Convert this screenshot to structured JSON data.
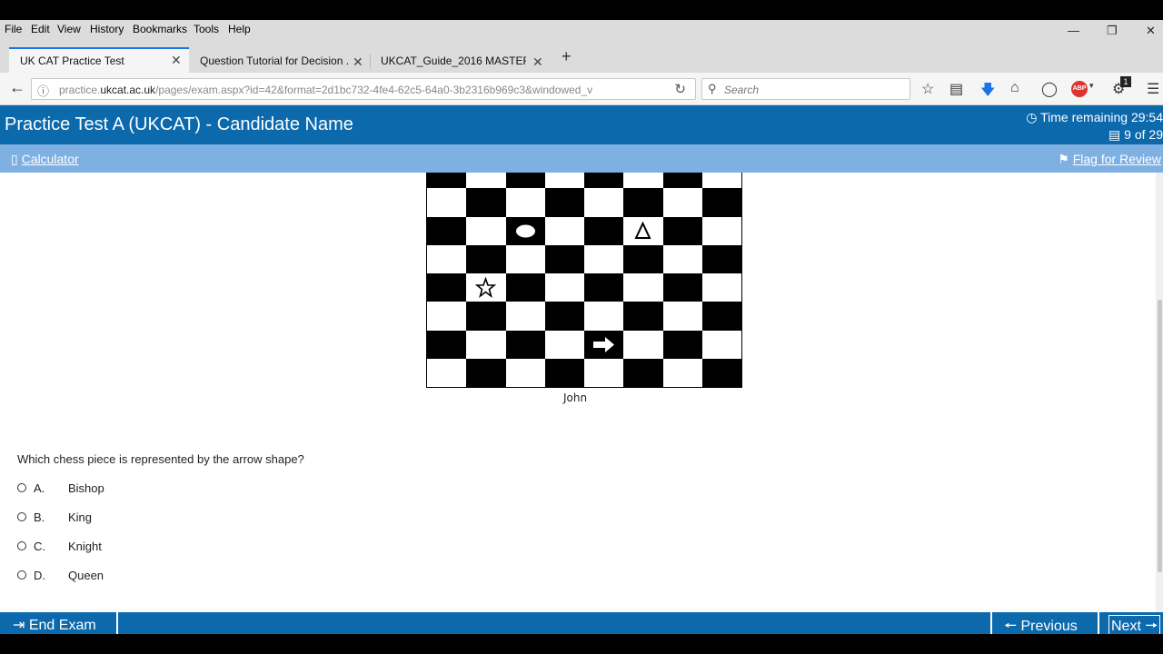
{
  "browser": {
    "menu": [
      "File",
      "Edit",
      "View",
      "History",
      "Bookmarks",
      "Tools",
      "Help"
    ],
    "tabs": [
      {
        "title": "UK CAT Practice Test"
      },
      {
        "title": "Question Tutorial for Decision ..."
      },
      {
        "title": "UKCAT_Guide_2016 MASTER.i..."
      }
    ],
    "url_prefix": "practice.",
    "url_domain": "ukcat.ac.uk",
    "url_rest": "/pages/exam.aspx?id=42&format=2d1bc732-4fe4-62c5-64a0-3b2316b969c3&windowed_v",
    "search_placeholder": "Search",
    "badge_count": "1",
    "abp_label": "ABP"
  },
  "app": {
    "title": "Practice Test A (UKCAT) - Candidate Name",
    "time_remaining": "Time remaining 29:54",
    "question_count": "9 of 29",
    "calculator_label": "Calculator",
    "flag_label": "Flag for Review"
  },
  "board": {
    "caption": "John",
    "pieces": [
      "ellipse",
      "triangle",
      "star",
      "arrow"
    ]
  },
  "question": {
    "text": "Which chess piece is represented by the arrow shape?",
    "options": [
      {
        "letter": "A.",
        "label": "Bishop"
      },
      {
        "letter": "B.",
        "label": "King"
      },
      {
        "letter": "C.",
        "label": "Knight"
      },
      {
        "letter": "D.",
        "label": "Queen"
      }
    ]
  },
  "footer": {
    "end_exam": "End Exam",
    "previous": "Previous",
    "next": "Next"
  },
  "colors": {
    "header_blue": "#0b69ac",
    "toolbar_blue": "#7fb0e2"
  }
}
